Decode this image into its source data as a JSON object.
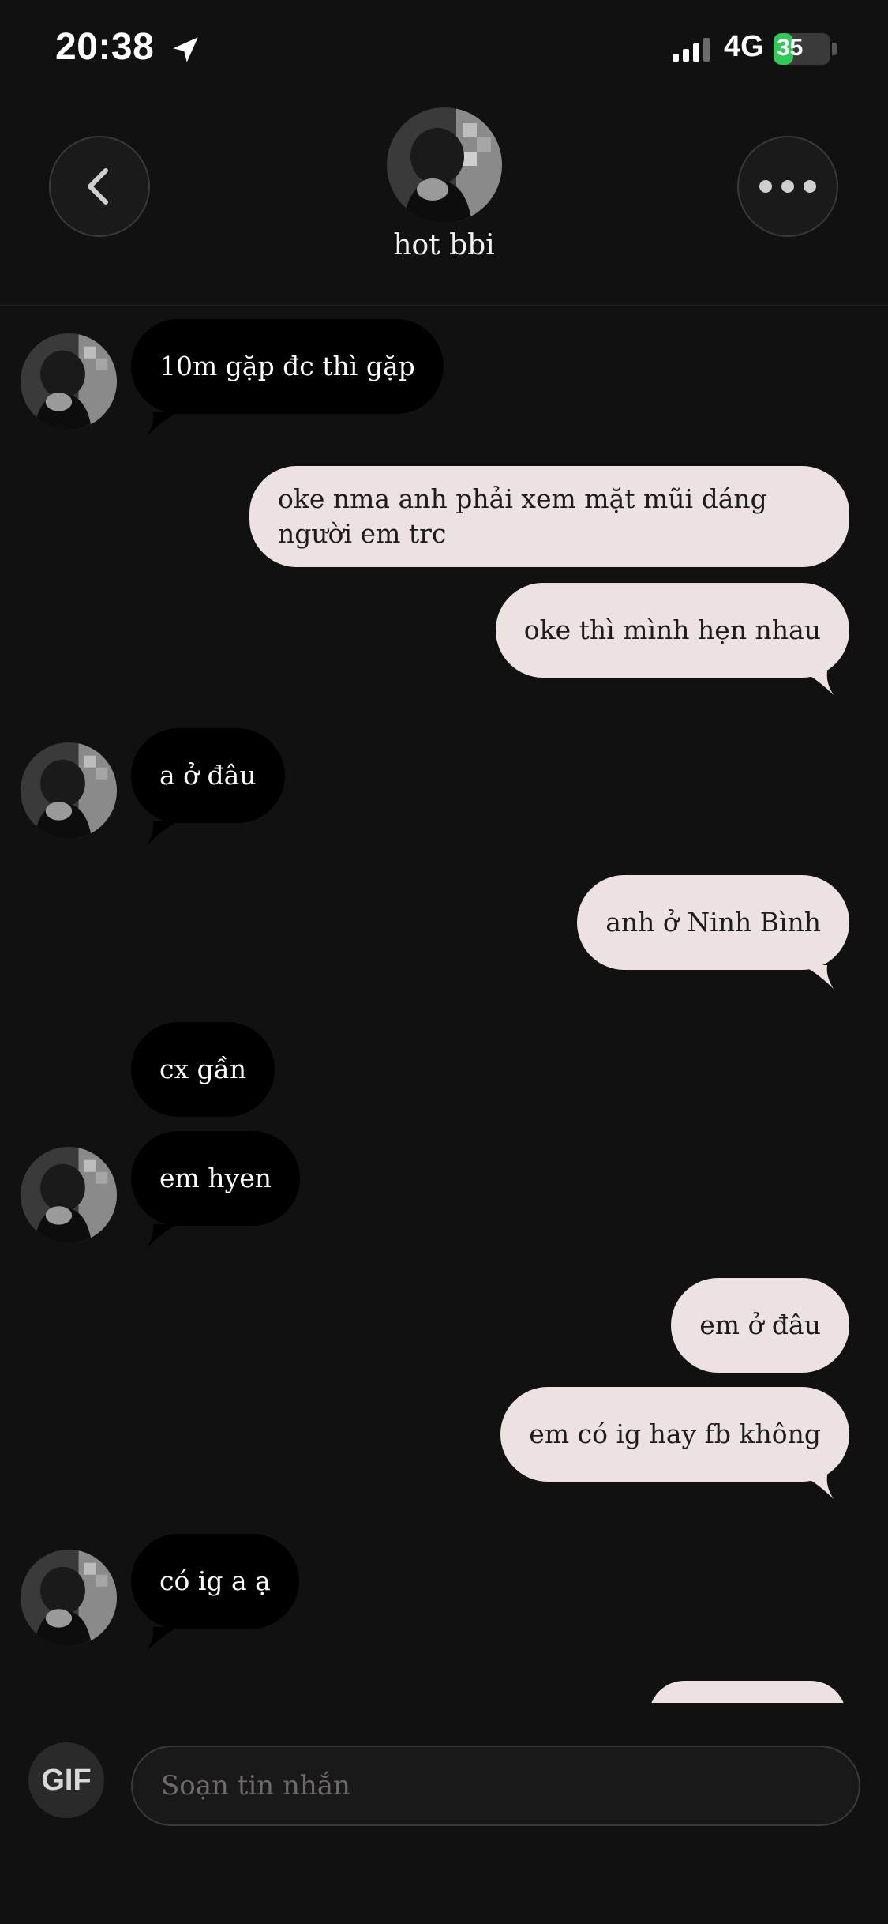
{
  "status_bar": {
    "time": "20:38",
    "network": "4G",
    "battery": "35",
    "battery_level": 0.35,
    "icons": [
      "location-arrow-icon",
      "signal-icon",
      "battery-icon"
    ]
  },
  "header": {
    "contact_name": "hot bbi",
    "icons": [
      "chevron-left-icon",
      "more-dots-icon"
    ]
  },
  "messages": [
    {
      "side": "in",
      "text": "10m gặp đc thì gặp"
    },
    {
      "side": "out",
      "text": "oke nma anh phải xem mặt mũi dáng người em trc"
    },
    {
      "side": "out",
      "text": "oke thì mình hẹn nhau"
    },
    {
      "side": "in",
      "text": "a ở đâu"
    },
    {
      "side": "out",
      "text": "anh ở Ninh Bình"
    },
    {
      "side": "in",
      "text": "cx gần"
    },
    {
      "side": "in",
      "text": "em hyen"
    },
    {
      "side": "out",
      "text": "em ở đâu"
    },
    {
      "side": "out",
      "text": "em có ig hay fb không"
    },
    {
      "side": "in",
      "text": "có ig a ạ"
    }
  ],
  "compose": {
    "gif_label": "GIF",
    "placeholder": "Soạn tin nhắn"
  },
  "colors": {
    "background": "#121111",
    "incoming_bubble": "#000000",
    "outgoing_bubble": "#ece2e2",
    "battery_green": "#34c759"
  }
}
